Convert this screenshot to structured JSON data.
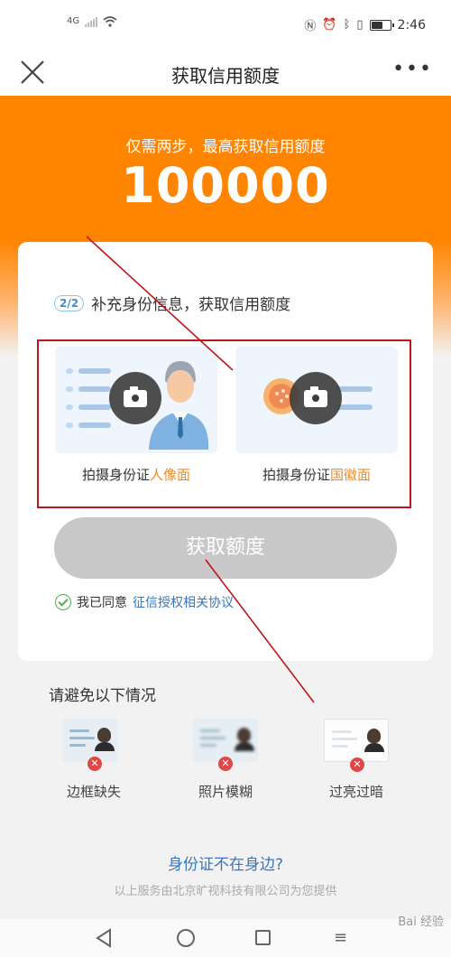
{
  "status_bar": {
    "network": "4G",
    "time": "2:46",
    "icons": [
      "signal-icon",
      "wifi-icon",
      "nfc-icon",
      "alarm-icon",
      "bluetooth-icon",
      "vibrate-icon",
      "battery-icon"
    ],
    "battery_level": 0.55
  },
  "nav": {
    "title": "获取信用额度",
    "close_icon": "close-icon",
    "more_icon": "more-icon"
  },
  "hero": {
    "subtitle": "仅需两步，最高获取信用额度",
    "amount": "100000",
    "color": "#ff8400"
  },
  "card": {
    "step_badge": "2/2",
    "step_text": "补充身份信息，获取信用额度",
    "front": {
      "label_prefix": "拍摄身份证",
      "label_highlight": "人像面",
      "icon": "camera-icon"
    },
    "back": {
      "label_prefix": "拍摄身份证",
      "label_highlight": "国徽面",
      "icon": "camera-icon"
    },
    "submit_label": "获取额度",
    "agree_prefix": "我已同意",
    "agree_link": "征信授权相关协议"
  },
  "avoid": {
    "title": "请避免以下情况",
    "items": [
      {
        "label": "边框缺失"
      },
      {
        "label": "照片模糊"
      },
      {
        "label": "过亮过暗"
      }
    ]
  },
  "footer": {
    "no_id_link": "身份证不在身边?",
    "provider": "以上服务由北京旷视科技有限公司为您提供",
    "watermark": "Bai 经验"
  },
  "colors": {
    "accent": "#ff8400",
    "highlight": "#f08a1c",
    "link": "#3a76b8",
    "annotation": "#c0141b"
  }
}
